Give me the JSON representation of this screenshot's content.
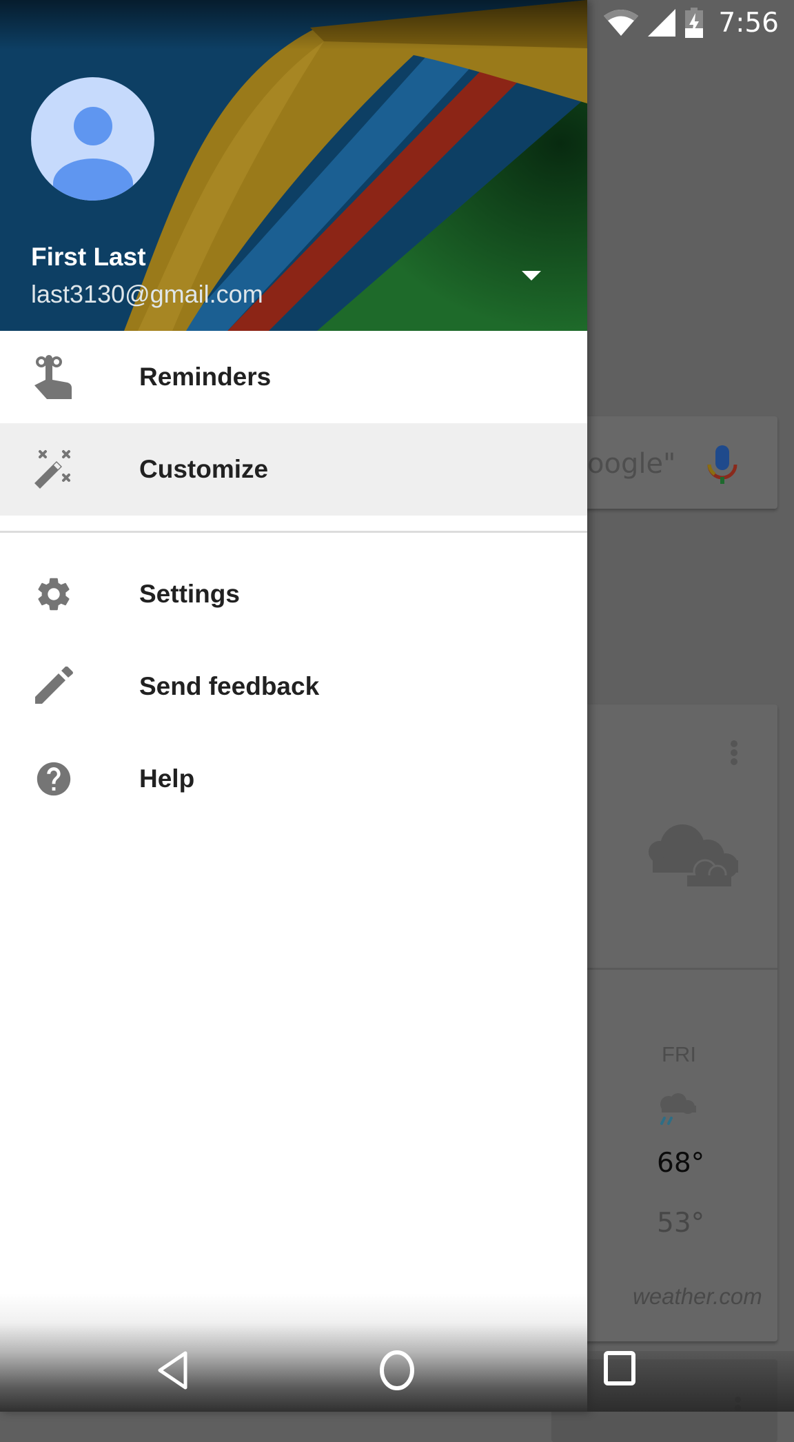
{
  "status_bar": {
    "time": "7:56",
    "icons": [
      "wifi-icon",
      "cell-signal-icon",
      "battery-charging-icon"
    ]
  },
  "drawer": {
    "account": {
      "name": "First Last",
      "email": "last3130@gmail.com",
      "avatar_icon": "default-avatar-icon",
      "dropdown_icon": "arrow-drop-down-icon"
    },
    "menu_primary": [
      {
        "label": "Reminders",
        "icon": "reminder-finger-icon",
        "active": false
      },
      {
        "label": "Customize",
        "icon": "magic-wand-icon",
        "active": true
      }
    ],
    "menu_secondary": [
      {
        "label": "Settings",
        "icon": "gear-icon"
      },
      {
        "label": "Send feedback",
        "icon": "pencil-icon"
      },
      {
        "label": "Help",
        "icon": "help-circle-icon"
      }
    ]
  },
  "background_app": {
    "search_hint_partial": "oogle\"",
    "search_mic_icon": "microphone-icon",
    "weather_card": {
      "condition_icon": "cloudy-icon",
      "forecast_day": "FRI",
      "forecast_icon": "rain-cloud-icon",
      "high": "68°",
      "low": "53°",
      "source": "weather.com"
    }
  },
  "nav_bar": {
    "buttons": [
      "back",
      "home",
      "recents"
    ]
  },
  "colors": {
    "avatar_bg": "#c6dafc",
    "avatar_fg": "#5f96f0",
    "active_item_bg": "#efefef",
    "menu_icon": "#757575",
    "menu_text": "#212121",
    "scrim": "#606060"
  }
}
